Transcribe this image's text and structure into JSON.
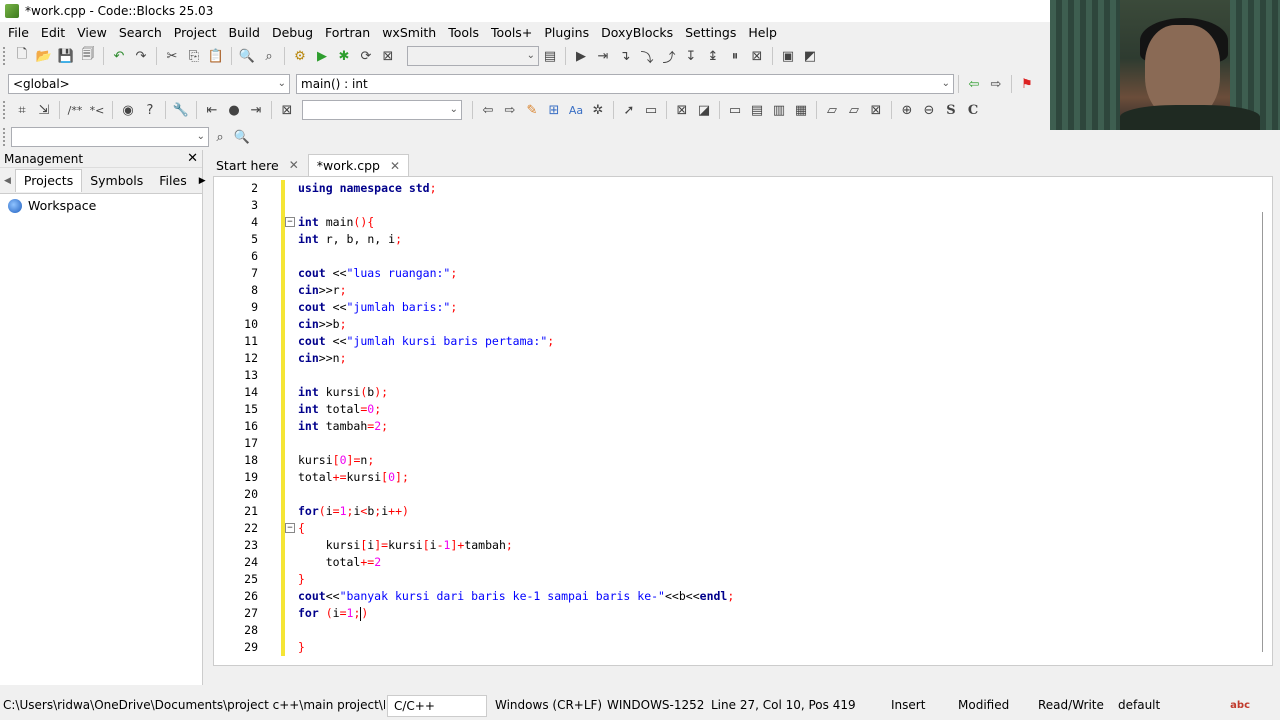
{
  "window": {
    "title": "*work.cpp - Code::Blocks 25.03"
  },
  "menu": [
    "File",
    "Edit",
    "View",
    "Search",
    "Project",
    "Build",
    "Debug",
    "Fortran",
    "wxSmith",
    "Tools",
    "Tools+",
    "Plugins",
    "DoxyBlocks",
    "Settings",
    "Help"
  ],
  "scope": {
    "global": "<global>",
    "function": "main() : int"
  },
  "management": {
    "title": "Management",
    "tabs": [
      "Projects",
      "Symbols",
      "Files"
    ],
    "workspace": "Workspace"
  },
  "tabs": [
    {
      "label": "Start here"
    },
    {
      "label": "*work.cpp"
    }
  ],
  "editor": {
    "lines": [
      {
        "n": "2",
        "text": "using namespace std;"
      },
      {
        "n": "3",
        "text": ""
      },
      {
        "n": "4",
        "text": "int main(){"
      },
      {
        "n": "5",
        "text": "int r, b, n, i;"
      },
      {
        "n": "6",
        "text": ""
      },
      {
        "n": "7",
        "text": "cout <<\"luas ruangan:\";"
      },
      {
        "n": "8",
        "text": "cin>>r;"
      },
      {
        "n": "9",
        "text": "cout <<\"jumlah baris:\";"
      },
      {
        "n": "10",
        "text": "cin>>b;"
      },
      {
        "n": "11",
        "text": "cout <<\"jumlah kursi baris pertama:\";"
      },
      {
        "n": "12",
        "text": "cin>>n;"
      },
      {
        "n": "13",
        "text": ""
      },
      {
        "n": "14",
        "text": "int kursi(b);"
      },
      {
        "n": "15",
        "text": "int total=0;"
      },
      {
        "n": "16",
        "text": "int tambah=2;"
      },
      {
        "n": "17",
        "text": ""
      },
      {
        "n": "18",
        "text": "kursi[0]=n;"
      },
      {
        "n": "19",
        "text": "total+=kursi[0];"
      },
      {
        "n": "20",
        "text": ""
      },
      {
        "n": "21",
        "text": "for(i=1;i<b;i++)"
      },
      {
        "n": "22",
        "text": "{"
      },
      {
        "n": "23",
        "text": "    kursi[i]=kursi[i-1]+tambah;"
      },
      {
        "n": "24",
        "text": "    total+=2"
      },
      {
        "n": "25",
        "text": "}"
      },
      {
        "n": "26",
        "text": "cout<<\"banyak kursi dari baris ke-1 sampai baris ke-\"<<b<<endl;"
      },
      {
        "n": "27",
        "text": "for (i=1;)"
      },
      {
        "n": "28",
        "text": ""
      },
      {
        "n": "29",
        "text": "}"
      }
    ]
  },
  "status": {
    "path": "C:\\Users\\ridwa\\OneDrive\\Documents\\project c++\\main project\\New ...",
    "lang": "C/C++",
    "eol": "Windows (CR+LF)",
    "encoding": "WINDOWS-1252",
    "position": "Line 27, Col 10, Pos 419",
    "mode": "Insert",
    "modified": "Modified",
    "access": "Read/Write",
    "profile": "default",
    "spell_icon": "abc"
  }
}
